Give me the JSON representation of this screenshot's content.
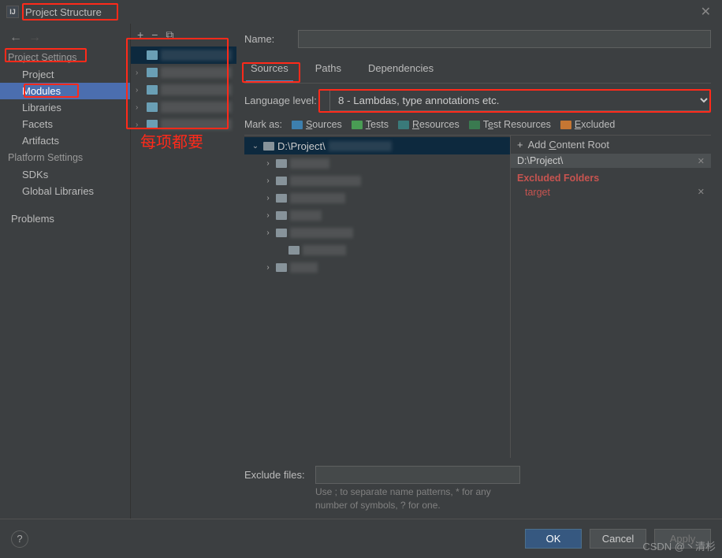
{
  "window": {
    "title": "Project Structure"
  },
  "sidebar": {
    "sections": {
      "project_settings": "Project Settings",
      "platform_settings": "Platform Settings"
    },
    "items": {
      "project": "Project",
      "modules": "Modules",
      "libraries": "Libraries",
      "facets": "Facets",
      "artifacts": "Artifacts",
      "sdks": "SDKs",
      "global_libraries": "Global Libraries",
      "problems": "Problems"
    }
  },
  "modules_toolbar": {
    "add": "+",
    "remove": "−",
    "copy": "⧉"
  },
  "name_field": {
    "label": "Name:"
  },
  "tabs": {
    "sources": "Sources",
    "paths": "Paths",
    "dependencies": "Dependencies"
  },
  "language_level": {
    "label": "Language level:",
    "value": "8 - Lambdas, type annotations etc."
  },
  "mark_as": {
    "label": "Mark as:",
    "sources": "Sources",
    "tests": "Tests",
    "resources": "Resources",
    "test_resources": "Test Resources",
    "excluded": "Excluded"
  },
  "tree": {
    "root": "D:\\Project\\"
  },
  "right": {
    "add_content_root": "Add Content Root",
    "content_root_path": "D:\\Project\\",
    "excluded_header": "Excluded Folders",
    "excluded_items": [
      "target"
    ]
  },
  "exclude_files": {
    "label": "Exclude files:",
    "hint1": "Use ; to separate name patterns, * for any",
    "hint2": "number of symbols, ? for one."
  },
  "footer": {
    "ok": "OK",
    "cancel": "Cancel",
    "apply": "Apply"
  },
  "annotations": {
    "red_text": "每项都要"
  },
  "watermark": "CSDN @丶清杉"
}
